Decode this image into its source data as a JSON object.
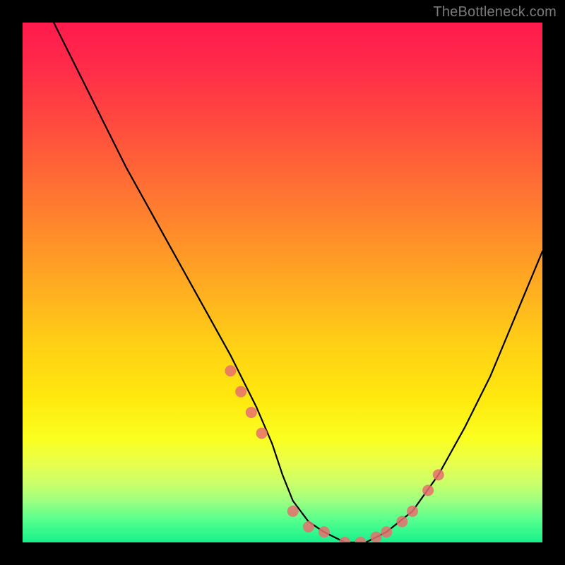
{
  "watermark": "TheBottleneck.com",
  "chart_data": {
    "type": "line",
    "title": "",
    "xlabel": "",
    "ylabel": "",
    "xlim": [
      0,
      100
    ],
    "ylim": [
      0,
      100
    ],
    "grid": false,
    "legend": false,
    "background_gradient": {
      "top": "#ff1a4d",
      "mid": "#ffe80e",
      "bottom": "#18f08c"
    },
    "series": [
      {
        "name": "bottleneck-curve",
        "type": "line",
        "color": "#000000",
        "x": [
          6,
          10,
          15,
          20,
          25,
          30,
          35,
          40,
          45,
          48,
          50,
          52,
          55,
          58,
          62,
          66,
          70,
          75,
          80,
          85,
          90,
          95,
          100
        ],
        "y": [
          100,
          92,
          82,
          72,
          63,
          54,
          45,
          36,
          26,
          19,
          13,
          8,
          4,
          2,
          0,
          0,
          2,
          6,
          13,
          22,
          32,
          44,
          56
        ]
      },
      {
        "name": "curve-markers",
        "type": "scatter",
        "color": "#e86f6f",
        "x": [
          40,
          42,
          44,
          46,
          52,
          55,
          58,
          62,
          65,
          68,
          70,
          73,
          75,
          78,
          80
        ],
        "y": [
          33,
          29,
          25,
          21,
          6,
          3,
          2,
          0,
          0,
          1,
          2,
          4,
          6,
          10,
          13
        ]
      }
    ]
  }
}
